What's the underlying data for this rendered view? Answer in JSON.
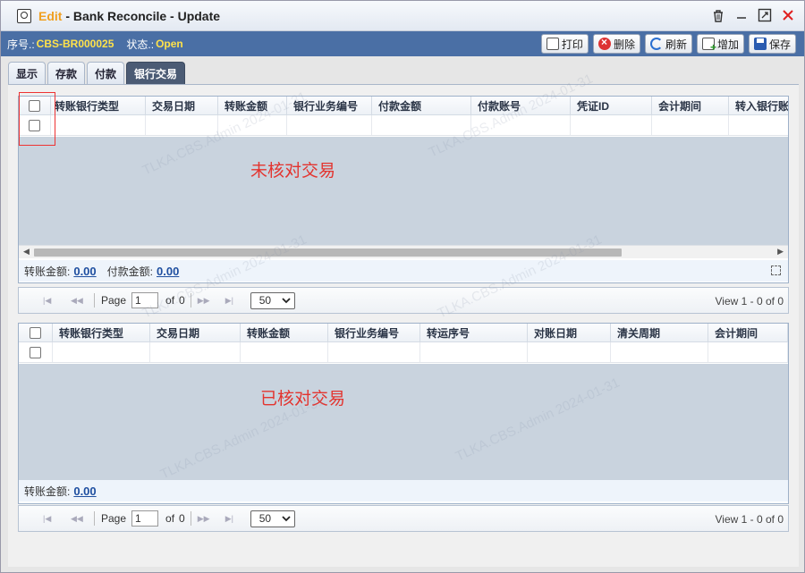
{
  "window": {
    "title_prefix": "Edit",
    "title_main": " - Bank Reconcile - Update"
  },
  "info": {
    "seq_label": "序号.:",
    "seq_value": "CBS-BR000025",
    "status_label": "状态.:",
    "status_value": "Open"
  },
  "actions": {
    "print": "打印",
    "delete": "删除",
    "refresh": "刷新",
    "add": "增加",
    "save": "保存"
  },
  "tabs": [
    {
      "label": "显示"
    },
    {
      "label": "存款"
    },
    {
      "label": "付款"
    },
    {
      "label": "银行交易",
      "active": true
    }
  ],
  "grid_top": {
    "columns": [
      "转账银行类型",
      "交易日期",
      "转账金额",
      "银行业务编号",
      "付款金额",
      "付款账号",
      "凭证ID",
      "会计期间",
      "转入银行账"
    ],
    "note": "未核对交易",
    "totals": [
      {
        "label": "转账金额:",
        "value": "0.00"
      },
      {
        "label": "付款金额:",
        "value": "0.00"
      }
    ],
    "pager": {
      "page_label": "Page",
      "page": "1",
      "of_label": "of",
      "pages": "0",
      "page_size": "50",
      "view": "View  1 - 0  of 0"
    }
  },
  "grid_bottom": {
    "columns": [
      "转账银行类型",
      "交易日期",
      "转账金额",
      "银行业务编号",
      "转运序号",
      "对账日期",
      "清关周期",
      "会计期间"
    ],
    "note": "已核对交易",
    "totals": [
      {
        "label": "转账金额:",
        "value": "0.00"
      }
    ],
    "pager": {
      "page_label": "Page",
      "page": "1",
      "of_label": "of",
      "pages": "0",
      "page_size": "50",
      "view": "View  1 - 0  of 0"
    }
  },
  "watermark": "TLKA.CBS.Admin 2024-01-31",
  "icons": {
    "title": "search-window-icon",
    "delete_tool": "trash-icon",
    "minimize": "minimize-icon",
    "maximize": "maximize-icon",
    "close": "close-icon"
  },
  "colors": {
    "accent": "#4a6fa5",
    "status": "#ffe24a",
    "edit": "#f0a020",
    "note": "#e3342f"
  }
}
